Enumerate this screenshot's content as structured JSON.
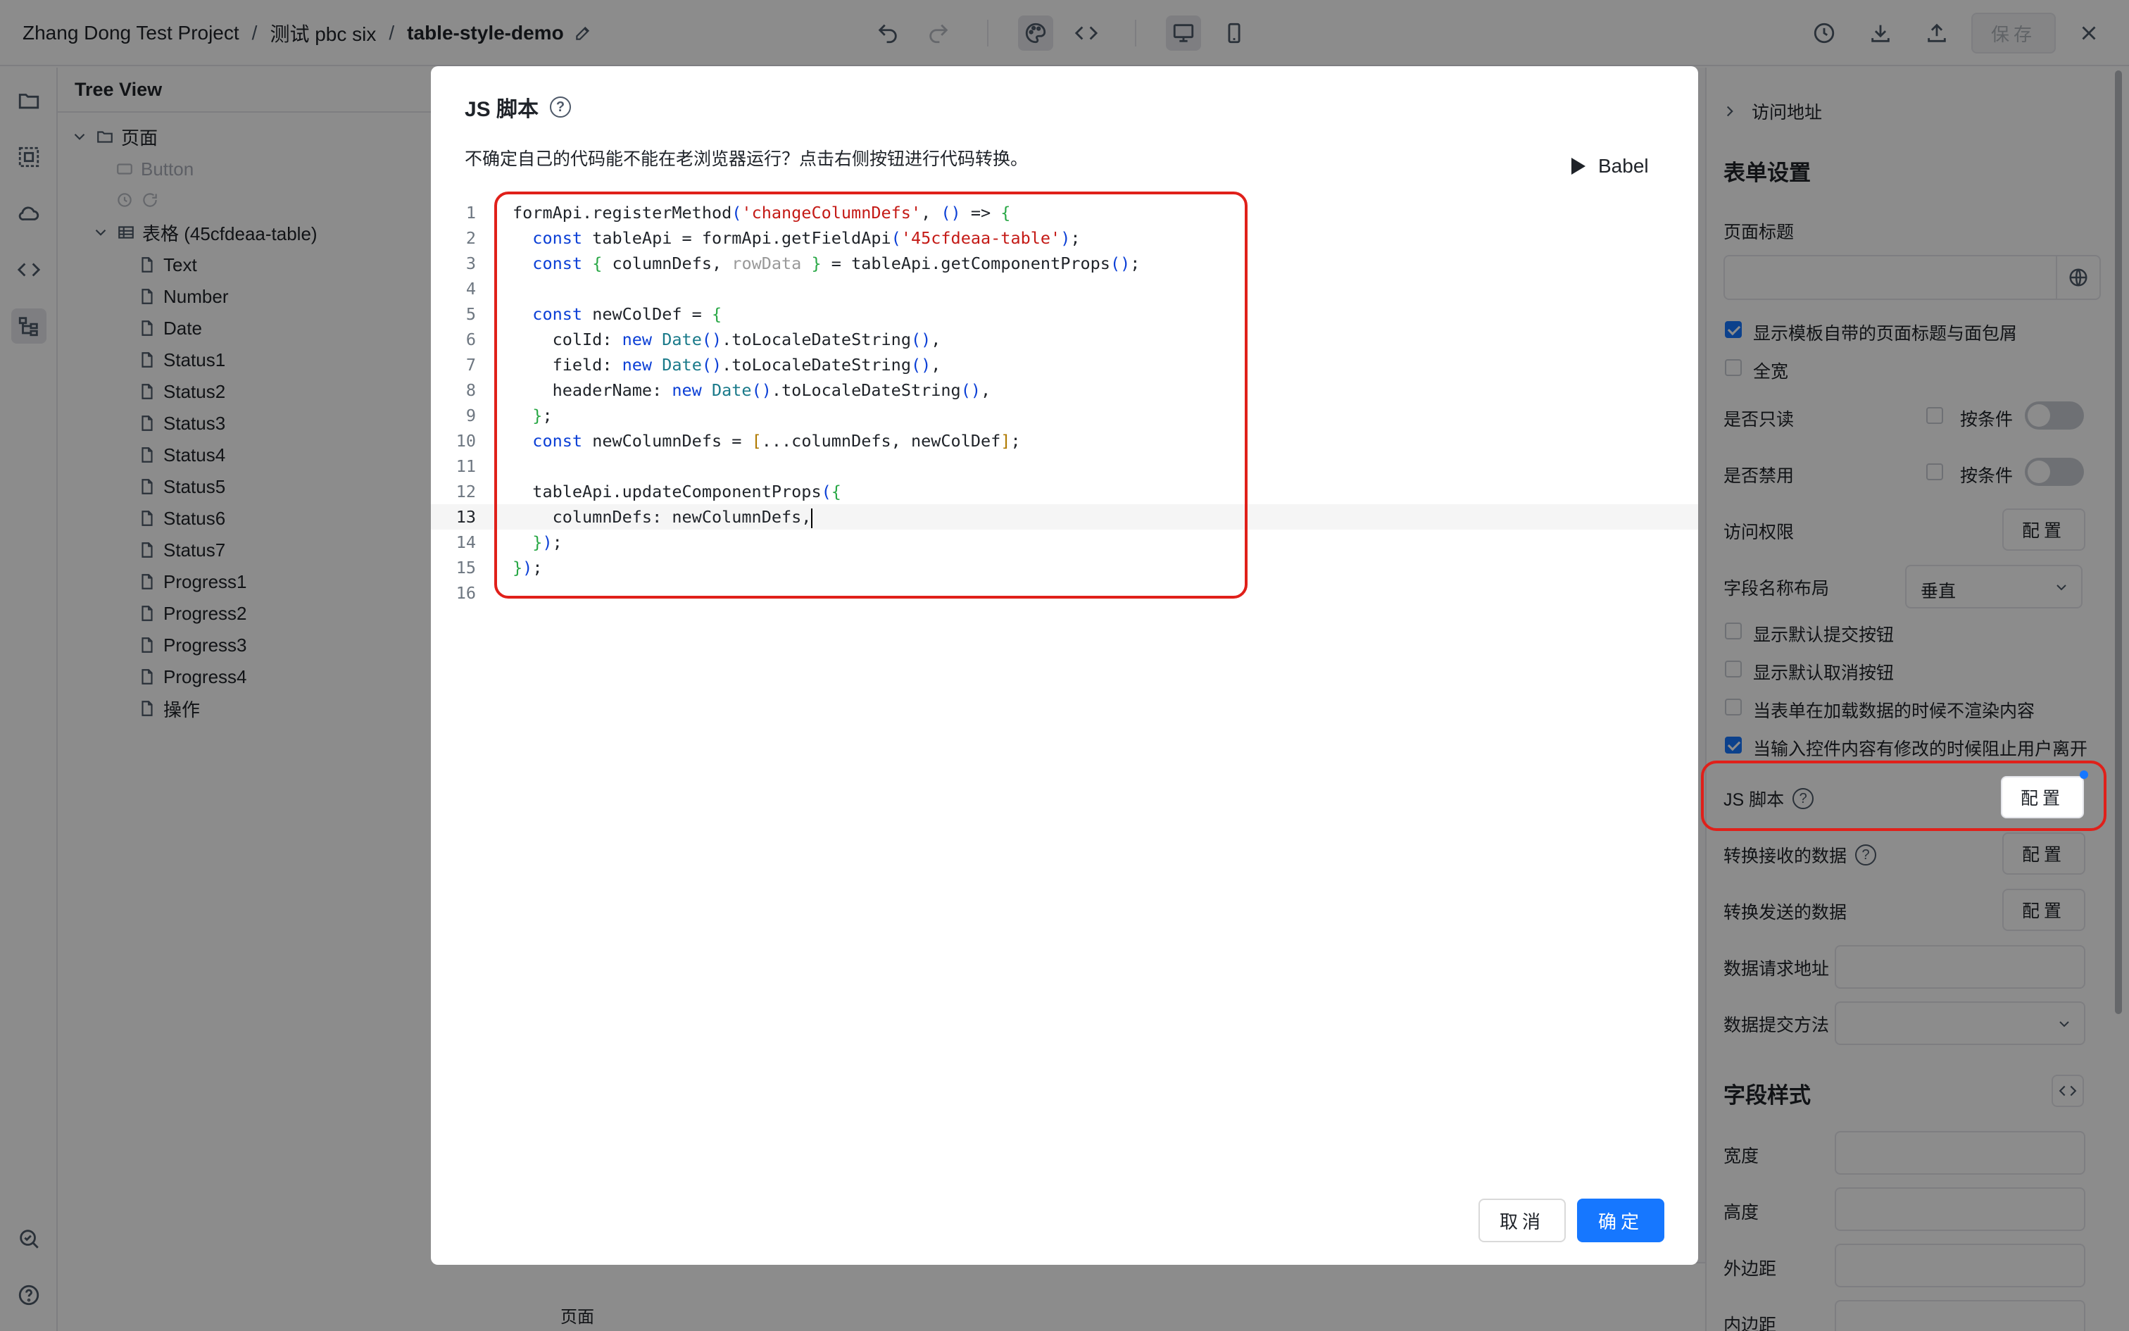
{
  "topbar": {
    "project": "Zhang Dong Test Project",
    "sep1": "/",
    "app": "测试 pbc six",
    "sep2": "/",
    "page": "table-style-demo",
    "save_label": "保存"
  },
  "tree": {
    "title": "Tree View",
    "root": "页面",
    "button": "Button",
    "table": "表格 (45cfdeaa-table)",
    "columns": [
      "Text",
      "Number",
      "Date",
      "Status1",
      "Status2",
      "Status3",
      "Status4",
      "Status5",
      "Status6",
      "Status7",
      "Progress1",
      "Progress2",
      "Progress3",
      "Progress4",
      "操作"
    ]
  },
  "canvas": {
    "footer_label": "页面"
  },
  "settings": {
    "visit_address": "访问地址",
    "form_settings": "表单设置",
    "page_title_label": "页面标题",
    "show_breadcrumb": "显示模板自带的页面标题与面包屑",
    "fullwidth": "全宽",
    "readonly": "是否只读",
    "disabled": "是否禁用",
    "by_condition": "按条件",
    "access": "访问权限",
    "config": "配置",
    "label_layout": "字段名称布局",
    "label_layout_value": "垂直",
    "show_submit": "显示默认提交按钮",
    "show_cancel": "显示默认取消按钮",
    "no_render_loading": "当表单在加载数据的时候不渲染内容",
    "prevent_leave": "当输入控件内容有修改的时候阻止用户离开",
    "js_script": "JS 脚本",
    "transform_receive": "转换接收的数据",
    "transform_send": "转换发送的数据",
    "request_url": "数据请求地址",
    "submit_method": "数据提交方法",
    "field_style": "字段样式",
    "width": "宽度",
    "height": "高度",
    "margin": "外边距",
    "padding": "内边距"
  },
  "modal": {
    "title": "JS 脚本",
    "description": "不确定自己的代码能不能在老浏览器运行？点击右侧按钮进行代码转换。",
    "babel_label": "Babel",
    "cancel_label": "取消",
    "ok_label": "确定",
    "active_line": 13,
    "code_lines": [
      "formApi.registerMethod('changeColumnDefs', () => {",
      "  const tableApi = formApi.getFieldApi('45cfdeaa-table');",
      "  const { columnDefs, rowData } = tableApi.getComponentProps();",
      "",
      "  const newColDef = {",
      "    colId: new Date().toLocaleDateString(),",
      "    field: new Date().toLocaleDateString(),",
      "    headerName: new Date().toLocaleDateString(),",
      "  };",
      "  const newColumnDefs = [...columnDefs, newColDef];",
      "",
      "  tableApi.updateComponentProps({",
      "    columnDefs: newColumnDefs,",
      "  });",
      "});",
      ""
    ]
  },
  "colors": {
    "accent": "#1677ff",
    "highlight": "#e0201a",
    "keyword": "#0b3fd6",
    "string": "#c41a16"
  }
}
